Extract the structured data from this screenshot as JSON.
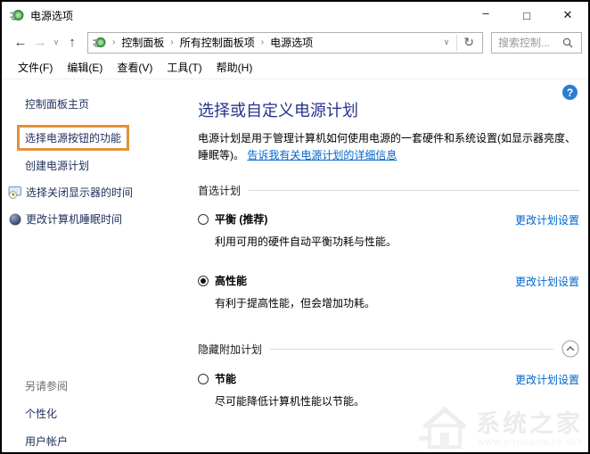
{
  "window": {
    "title": "电源选项",
    "minimize_glyph": "–",
    "maximize_glyph": "□",
    "close_glyph": "✕"
  },
  "navbar": {
    "back_glyph": "←",
    "forward_glyph": "→",
    "history_chevron_glyph": "∨",
    "up_glyph": "↑",
    "breadcrumb_separator": "›",
    "breadcrumb": [
      "控制面板",
      "所有控制面板项",
      "电源选项"
    ],
    "address_chevron_glyph": "∨",
    "refresh_glyph": "↻",
    "search_placeholder": "搜索控制..."
  },
  "menubar": {
    "file": "文件(F)",
    "edit": "编辑(E)",
    "view": "查看(V)",
    "tools": "工具(T)",
    "help": "帮助(H)"
  },
  "sidebar": {
    "home": "控制面板主页",
    "tasks": [
      {
        "label": "选择电源按钮的功能",
        "highlighted": true
      },
      {
        "label": "创建电源计划"
      },
      {
        "label": "选择关闭显示器的时间"
      },
      {
        "label": "更改计算机睡眠时间"
      }
    ],
    "see_also": "另请参阅",
    "see_also_links": [
      {
        "label": "个性化"
      },
      {
        "label": "用户帐户"
      }
    ]
  },
  "main": {
    "help_glyph": "?",
    "heading": "选择或自定义电源计划",
    "description": "电源计划是用于管理计算机如何使用电源的一套硬件和系统设置(如显示器亮度、睡眠等)。",
    "description_link": "告诉我有关电源计划的详细信息",
    "section1_title": "首选计划",
    "section2_title": "隐藏附加计划",
    "plans": [
      {
        "name": "平衡 (推荐)",
        "checked": false,
        "desc": "利用可用的硬件自动平衡功耗与性能。",
        "link": "更改计划设置"
      },
      {
        "name": "高性能",
        "checked": true,
        "desc": "有利于提高性能，但会增加功耗。",
        "link": "更改计划设置"
      },
      {
        "name": "节能",
        "checked": false,
        "desc": "尽可能降低计算机性能以节能。",
        "link": "更改计划设置"
      }
    ]
  },
  "watermark": {
    "text": "系统之家",
    "subtext": "WWW.XITONGZHIJIA.NET"
  },
  "colors": {
    "heading_navy": "#26348c",
    "link_blue": "#0066cc",
    "sidebar_navy": "#21305c",
    "highlight_orange": "#e3913a",
    "help_blue": "#2b7cd3"
  }
}
